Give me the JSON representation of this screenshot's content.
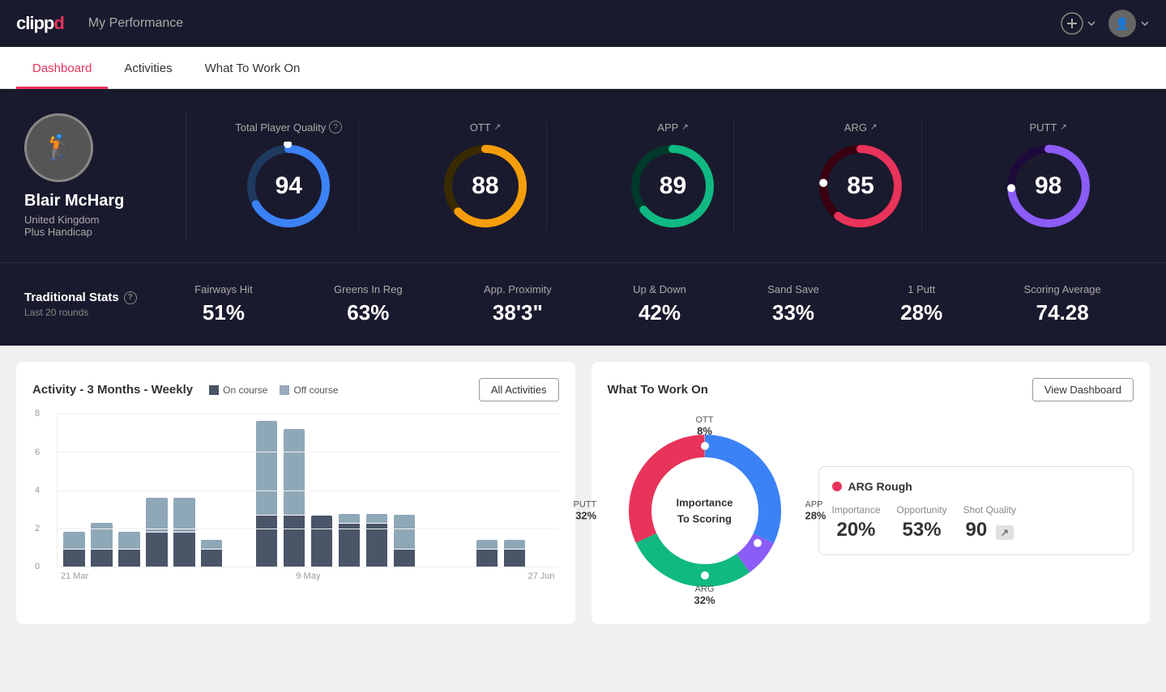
{
  "app": {
    "logo": "clippd",
    "header_title": "My Performance"
  },
  "nav": {
    "tabs": [
      {
        "label": "Dashboard",
        "active": true
      },
      {
        "label": "Activities",
        "active": false
      },
      {
        "label": "What To Work On",
        "active": false
      }
    ]
  },
  "player": {
    "name": "Blair McHarg",
    "country": "United Kingdom",
    "handicap": "Plus Handicap"
  },
  "scores": {
    "total": {
      "label": "Total Player Quality",
      "value": 94,
      "color": "#3b82f6",
      "bg_color": "#1e3a5f"
    },
    "ott": {
      "label": "OTT",
      "value": 88,
      "color": "#f59e0b",
      "bg_color": "#3a2a00"
    },
    "app": {
      "label": "APP",
      "value": 89,
      "color": "#10b981",
      "bg_color": "#003a2a"
    },
    "arg": {
      "label": "ARG",
      "value": 85,
      "color": "#e8335a",
      "bg_color": "#3a0010"
    },
    "putt": {
      "label": "PUTT",
      "value": 98,
      "color": "#8b5cf6",
      "bg_color": "#1e0a3a"
    }
  },
  "traditional_stats": {
    "title": "Traditional Stats",
    "subtitle": "Last 20 rounds",
    "items": [
      {
        "name": "Fairways Hit",
        "value": "51%"
      },
      {
        "name": "Greens In Reg",
        "value": "63%"
      },
      {
        "name": "App. Proximity",
        "value": "38'3\""
      },
      {
        "name": "Up & Down",
        "value": "42%"
      },
      {
        "name": "Sand Save",
        "value": "33%"
      },
      {
        "name": "1 Putt",
        "value": "28%"
      },
      {
        "name": "Scoring Average",
        "value": "74.28"
      }
    ]
  },
  "activity_chart": {
    "title": "Activity - 3 Months - Weekly",
    "legend": {
      "on_course": "On course",
      "off_course": "Off course"
    },
    "button": "All Activities",
    "y_labels": [
      "0",
      "2",
      "4",
      "6",
      "8"
    ],
    "x_labels": [
      "21 Mar",
      "9 May",
      "27 Jun"
    ],
    "bars": [
      {
        "dark": 1,
        "light": 1
      },
      {
        "dark": 1,
        "light": 1.5
      },
      {
        "dark": 1,
        "light": 1
      },
      {
        "dark": 2,
        "light": 2
      },
      {
        "dark": 2,
        "light": 2
      },
      {
        "dark": 1,
        "light": 0.5
      },
      {
        "dark": 0,
        "light": 0
      },
      {
        "dark": 3,
        "light": 5.5
      },
      {
        "dark": 3,
        "light": 5
      },
      {
        "dark": 3,
        "light": 0
      },
      {
        "dark": 2.5,
        "light": 0.5
      },
      {
        "dark": 2.5,
        "light": 0.5
      },
      {
        "dark": 1,
        "light": 2
      },
      {
        "dark": 0,
        "light": 0
      },
      {
        "dark": 0,
        "light": 0
      },
      {
        "dark": 1,
        "light": 0.5
      },
      {
        "dark": 1,
        "light": 0.5
      },
      {
        "dark": 0,
        "light": 0
      }
    ]
  },
  "what_to_work_on": {
    "title": "What To Work On",
    "button": "View Dashboard",
    "donut_center": "Importance\nTo Scoring",
    "segments": [
      {
        "label": "OTT",
        "pct": "8%",
        "color": "#8b5cf6",
        "degrees": 29
      },
      {
        "label": "APP",
        "pct": "28%",
        "color": "#10b981",
        "degrees": 101
      },
      {
        "label": "ARG",
        "pct": "32%",
        "color": "#e8335a",
        "degrees": 115
      },
      {
        "label": "PUTT",
        "pct": "32%",
        "color": "#3b82f6",
        "degrees": 115
      }
    ],
    "detail": {
      "title": "ARG Rough",
      "dot_color": "#e8335a",
      "metrics": [
        {
          "label": "Importance",
          "value": "20%"
        },
        {
          "label": "Opportunity",
          "value": "53%"
        },
        {
          "label": "Shot Quality",
          "value": "90",
          "badge": ""
        }
      ]
    }
  }
}
